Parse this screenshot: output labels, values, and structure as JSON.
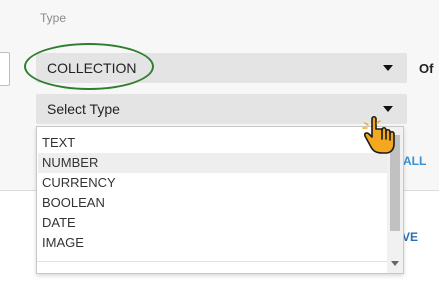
{
  "header": {
    "column_label": "Type"
  },
  "collection_select": {
    "value": "COLLECTION"
  },
  "side_label": "Of",
  "type_select": {
    "placeholder": "Select Type",
    "options": [
      "TEXT",
      "NUMBER",
      "CURRENCY",
      "BOOLEAN",
      "DATE",
      "IMAGE"
    ],
    "hovered_option": "NUMBER"
  },
  "links": {
    "partial_all": "ALL",
    "partial_save": "VE"
  },
  "colors": {
    "highlight_ellipse": "#2f7d2f",
    "link_blue": "#3b8fd3",
    "select_bg": "#e4e4e4",
    "cursor_fill": "#f4a820"
  },
  "icons": {
    "caret": "caret-down-icon",
    "cursor": "hand-pointer-icon"
  }
}
